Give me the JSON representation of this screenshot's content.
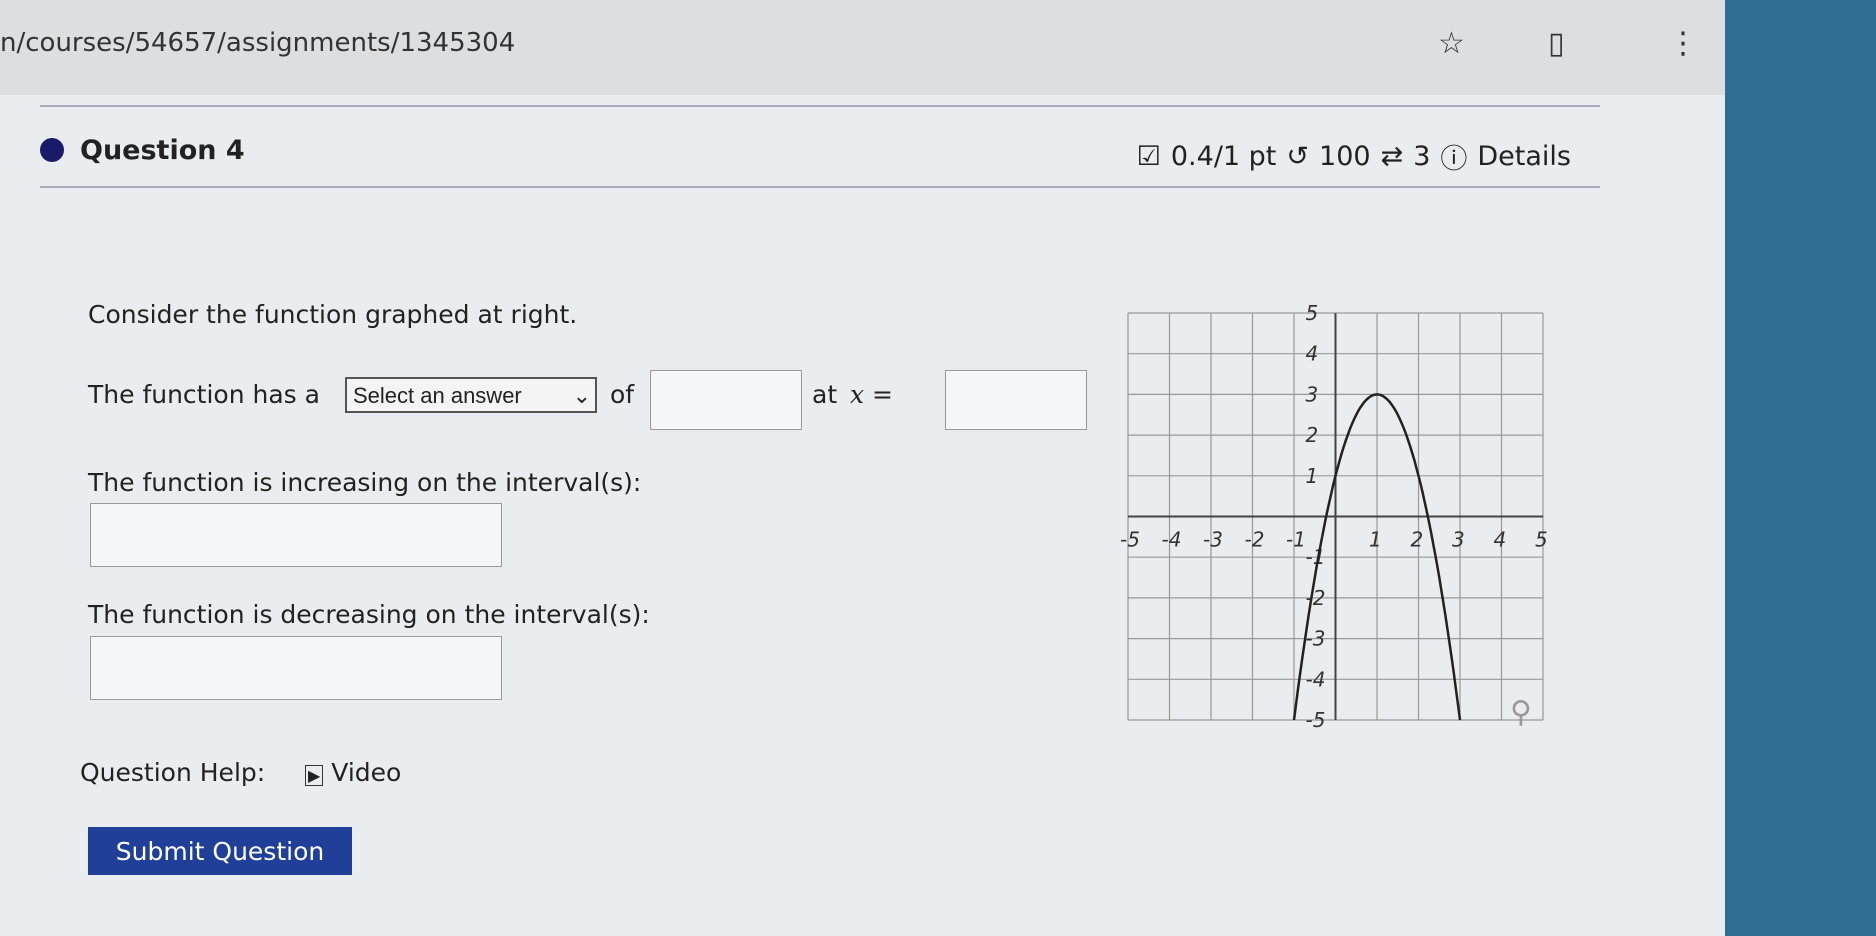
{
  "browser": {
    "url": "n/courses/54657/assignments/1345304",
    "icons": [
      "star-icon",
      "extension-icon",
      "more-icon"
    ]
  },
  "question": {
    "title": "Question 4",
    "score": "0.4/1 pt",
    "retries": "100",
    "attempts": "3",
    "details": "Details"
  },
  "prompt": {
    "intro": "Consider the function graphed at right.",
    "has_a": "The function has a",
    "select_placeholder": "Select an answer",
    "of": "of",
    "at": "at",
    "x_eq": "x =",
    "increasing": "The function is increasing on the interval(s):",
    "decreasing": "The function is decreasing on the interval(s):"
  },
  "help": {
    "label": "Question Help:",
    "video": "Video"
  },
  "submit": "Submit Question",
  "chart_data": {
    "type": "line",
    "function": "-2(x-1)^2+3",
    "x": [
      -1,
      -0.5,
      0,
      0.5,
      1,
      1.5,
      2,
      2.5,
      3
    ],
    "y": [
      -5,
      -1.5,
      1,
      2.5,
      3,
      2.5,
      1,
      -1.5,
      -5
    ],
    "xlim": [
      -5,
      5
    ],
    "ylim": [
      -5,
      5
    ],
    "xticks": [
      "-5",
      "-4",
      "-3",
      "-2",
      "-1",
      "1",
      "2",
      "3",
      "4",
      "5"
    ],
    "yticks": [
      "-5",
      "-4",
      "-3",
      "-2",
      "-1",
      "1",
      "2",
      "3",
      "4",
      "5"
    ],
    "grid": true
  }
}
